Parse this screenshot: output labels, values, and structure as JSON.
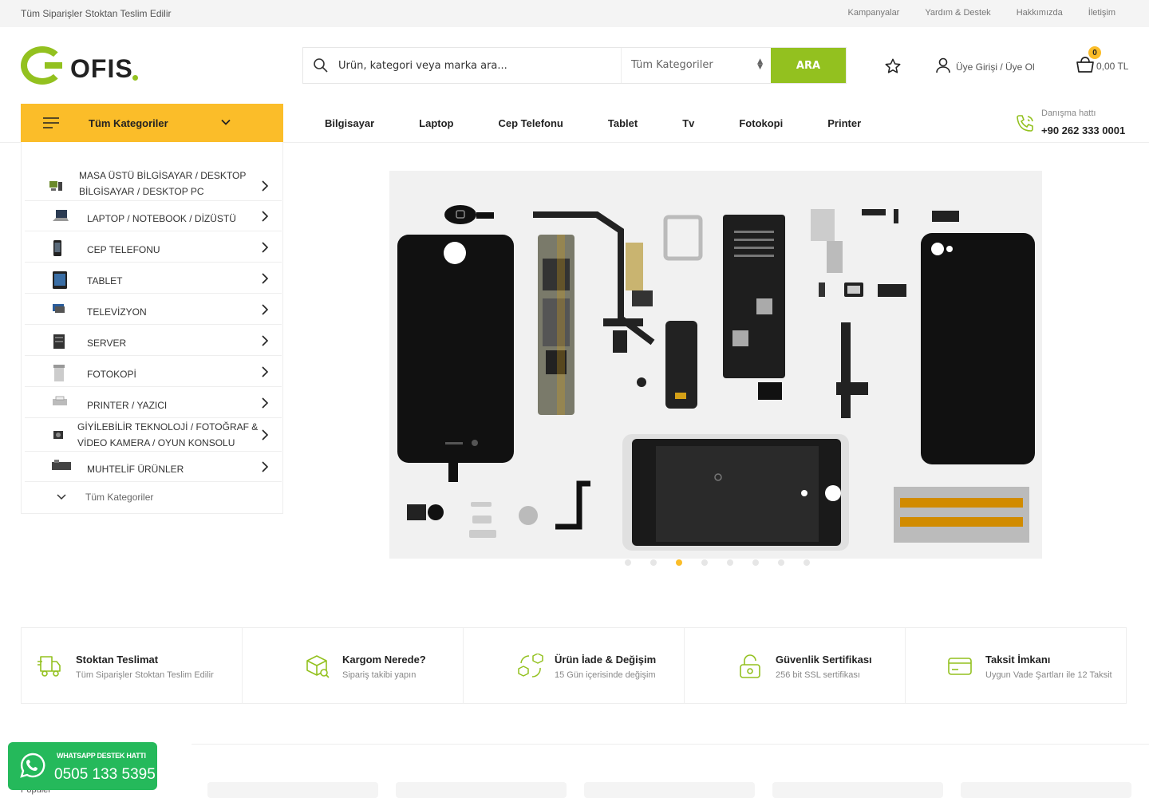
{
  "topbar": {
    "note": "Tüm Siparişler Stoktan Teslim Edilir",
    "links": [
      "Kampanyalar",
      "Yardım & Destek",
      "Hakkımızda",
      "İletişim"
    ]
  },
  "logo": {
    "text": "OFIS",
    "brand_color": "#93c11f"
  },
  "search": {
    "placeholder": "Ürün, kategori veya marka ara...",
    "category": "Tüm Kategoriler",
    "button": "ARA"
  },
  "header": {
    "account": "Üye Girişi / Üye Ol",
    "cart_count": "0",
    "cart_total": "0,00 TL"
  },
  "category_button": {
    "label": "Tüm Kategoriler"
  },
  "nav": [
    "Bilgisayar",
    "Laptop",
    "Cep Telefonu",
    "Tablet",
    "Tv",
    "Fotokopi",
    "Printer"
  ],
  "hotline": {
    "label": "Danışma hattı",
    "phone": "+90 262 333 0001"
  },
  "sidebar": {
    "items": [
      {
        "line1": "MASA ÜSTÜ BİLGİSAYAR / DESKTOP",
        "line2": "BİLGİSAYAR / DESKTOP PC",
        "icon": "desktop-icon"
      },
      {
        "line1": "LAPTOP / NOTEBOOK / DİZÜSTÜ",
        "line2": "",
        "icon": "laptop-icon"
      },
      {
        "line1": "CEP TELEFONU",
        "line2": "",
        "icon": "phone-icon"
      },
      {
        "line1": "TABLET",
        "line2": "",
        "icon": "tablet-icon"
      },
      {
        "line1": "TELEVİZYON",
        "line2": "",
        "icon": "tv-icon"
      },
      {
        "line1": "SERVER",
        "line2": "",
        "icon": "server-icon"
      },
      {
        "line1": "FOTOKOPİ",
        "line2": "",
        "icon": "copier-icon"
      },
      {
        "line1": "PRINTER / YAZICI",
        "line2": "",
        "icon": "printer-icon"
      },
      {
        "line1": "GİYİLEBİLİR TEKNOLOJİ / FOTOĞRAF &",
        "line2": "VİDEO KAMERA / OYUN KONSOLU",
        "icon": "camera-icon"
      },
      {
        "line1": "MUHTELİF ÜRÜNLER",
        "line2": "",
        "icon": "misc-icon"
      }
    ],
    "all_categories": "Tüm Kategoriler"
  },
  "slider": {
    "slide_count": 8,
    "active_index": 2,
    "active_color": "#fbbd29"
  },
  "features": [
    {
      "title": "Stoktan Teslimat",
      "subtitle": "Tüm Siparişler Stoktan Teslim Edilir",
      "icon": "delivery-truck-icon"
    },
    {
      "title": "Kargom Nerede?",
      "subtitle": "Sipariş takibi yapın",
      "icon": "package-search-icon"
    },
    {
      "title": "Ürün İade & Değişim",
      "subtitle": "15 Gün içerisinde değişim",
      "icon": "exchange-icon"
    },
    {
      "title": "Güvenlik Sertifikası",
      "subtitle": "256 bit SSL sertifikası",
      "icon": "lock-icon"
    },
    {
      "title": "Taksit İmkanı",
      "subtitle": "Uygun Vade Şartları ile 12 Taksit",
      "icon": "credit-card-icon"
    }
  ],
  "popular": "Popüler",
  "whatsapp": {
    "label": "WHATSAPP DESTEK HATTI",
    "phone": "0505 133 5395"
  },
  "colors": {
    "accent": "#93c11f",
    "secondary": "#fbbd29",
    "whatsapp": "#25b95b"
  }
}
